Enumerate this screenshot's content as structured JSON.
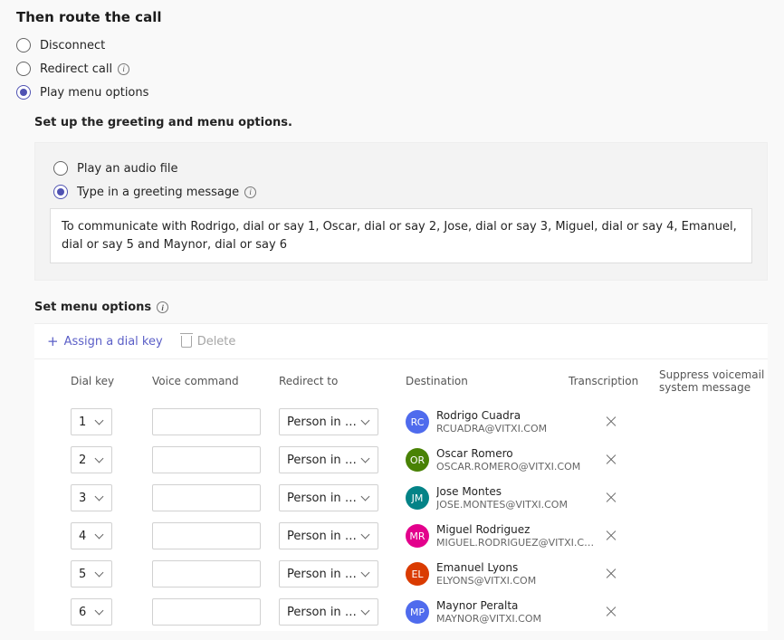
{
  "header": {
    "title": "Then route the call"
  },
  "routing": {
    "disconnect": "Disconnect",
    "redirect": "Redirect call",
    "play_menu": "Play menu options"
  },
  "greeting": {
    "section_title": "Set up the greeting and menu options.",
    "play_file": "Play an audio file",
    "type_msg": "Type in a greeting message",
    "text": "To communicate with Rodrigo, dial or say 1, Oscar, dial or say 2, Jose, dial or say 3, Miguel, dial or say 4, Emanuel, dial or say 5 and Maynor, dial or say 6"
  },
  "menu": {
    "title": "Set menu options",
    "assign": "Assign a dial key",
    "delete": "Delete",
    "cols": {
      "dial": "Dial key",
      "voice": "Voice command",
      "redirect": "Redirect to",
      "destination": "Destination",
      "transcription": "Transcription",
      "suppress": "Suppress voicemail system message"
    },
    "redirect_value": "Person in or...",
    "rows": [
      {
        "key": "1",
        "initials": "RC",
        "color": "#4f6bed",
        "name": "Rodrigo Cuadra",
        "email": "RCUADRA@VITXI.COM"
      },
      {
        "key": "2",
        "initials": "OR",
        "color": "#498205",
        "name": "Oscar Romero",
        "email": "OSCAR.ROMERO@VITXI.COM"
      },
      {
        "key": "3",
        "initials": "JM",
        "color": "#038387",
        "name": "Jose Montes",
        "email": "JOSE.MONTES@VITXI.COM"
      },
      {
        "key": "4",
        "initials": "MR",
        "color": "#e3008c",
        "name": "Miguel Rodriguez",
        "email": "MIGUEL.RODRIGUEZ@VITXI.COM"
      },
      {
        "key": "5",
        "initials": "EL",
        "color": "#da3b01",
        "name": "Emanuel Lyons",
        "email": "ELYONS@VITXI.COM"
      },
      {
        "key": "6",
        "initials": "MP",
        "color": "#4f6bed",
        "name": "Maynor Peralta",
        "email": "MAYNOR@VITXI.COM"
      }
    ]
  }
}
